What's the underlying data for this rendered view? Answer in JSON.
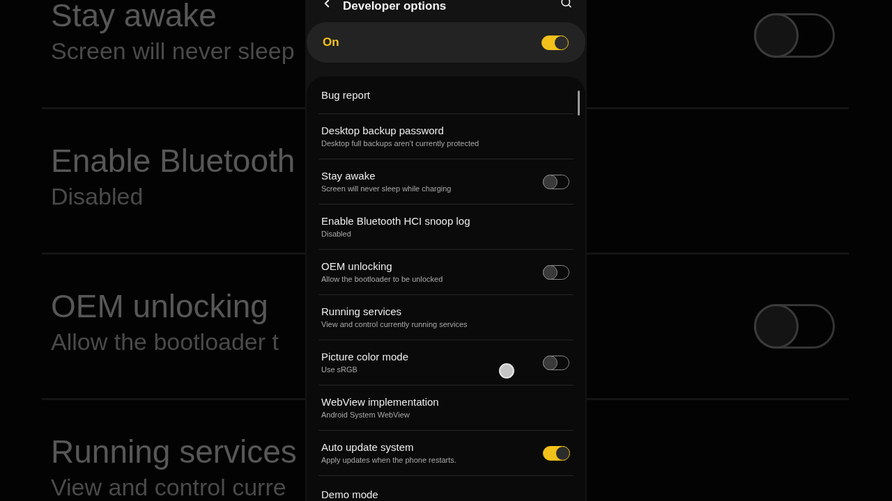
{
  "backdrop": {
    "rows": [
      {
        "kind": "switch",
        "title": "Stay awake",
        "summary": "Screen will never sleep",
        "on": false
      },
      {
        "kind": "plain",
        "title": "Enable Bluetooth",
        "summary": "Disabled"
      },
      {
        "kind": "switch",
        "title": "OEM unlocking",
        "summary": "Allow the bootloader t",
        "on": false
      },
      {
        "kind": "plain",
        "title": "Running services",
        "summary": "View and control curre"
      }
    ]
  },
  "header": {
    "title": "Developer options"
  },
  "master_switch": {
    "label": "On",
    "on": true
  },
  "settings": [
    {
      "kind": "plain",
      "title": "Bug report"
    },
    {
      "kind": "plain",
      "title": "Desktop backup password",
      "summary": "Desktop full backups aren’t currently protected"
    },
    {
      "kind": "switch",
      "title": "Stay awake",
      "summary": "Screen will never sleep while charging",
      "on": false
    },
    {
      "kind": "plain",
      "title": "Enable Bluetooth HCI snoop log",
      "summary": "Disabled"
    },
    {
      "kind": "switch",
      "title": "OEM unlocking",
      "summary": "Allow the bootloader to be unlocked",
      "on": false
    },
    {
      "kind": "plain",
      "title": "Running services",
      "summary": "View and control currently running services"
    },
    {
      "kind": "switch",
      "title": "Picture color mode",
      "summary": "Use sRGB",
      "on": false
    },
    {
      "kind": "plain",
      "title": "WebView implementation",
      "summary": "Android System WebView"
    },
    {
      "kind": "switch",
      "title": "Auto update system",
      "summary": "Apply updates when the phone restarts.",
      "on": true
    },
    {
      "kind": "plain",
      "title": "Demo mode"
    }
  ]
}
